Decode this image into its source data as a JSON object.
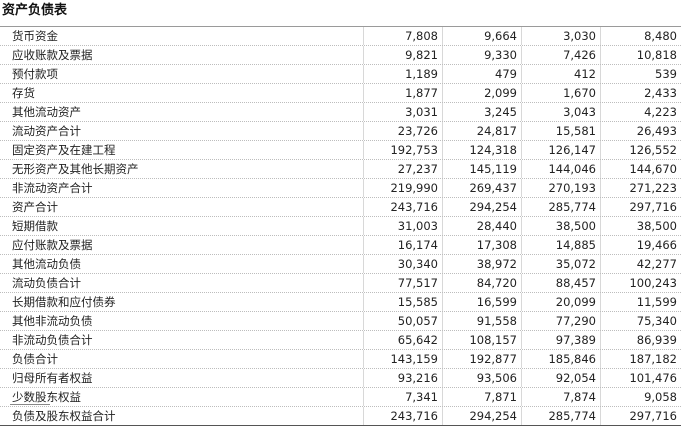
{
  "title": "资产负债表",
  "rows": [
    {
      "label": "货币资金",
      "values": [
        "7,808",
        "9,664",
        "3,030",
        "8,480"
      ]
    },
    {
      "label": "应收账款及票据",
      "values": [
        "9,821",
        "9,330",
        "7,426",
        "10,818"
      ]
    },
    {
      "label": "预付款项",
      "values": [
        "1,189",
        "479",
        "412",
        "539"
      ]
    },
    {
      "label": "存货",
      "values": [
        "1,877",
        "2,099",
        "1,670",
        "2,433"
      ]
    },
    {
      "label": "其他流动资产",
      "values": [
        "3,031",
        "3,245",
        "3,043",
        "4,223"
      ]
    },
    {
      "label": "流动资产合计",
      "values": [
        "23,726",
        "24,817",
        "15,581",
        "26,493"
      ]
    },
    {
      "label": "固定资产及在建工程",
      "values": [
        "192,753",
        "124,318",
        "126,147",
        "126,552"
      ]
    },
    {
      "label": "无形资产及其他长期资产",
      "values": [
        "27,237",
        "145,119",
        "144,046",
        "144,670"
      ]
    },
    {
      "label": "非流动资产合计",
      "values": [
        "219,990",
        "269,437",
        "270,193",
        "271,223"
      ]
    },
    {
      "label": "资产合计",
      "values": [
        "243,716",
        "294,254",
        "285,774",
        "297,716"
      ]
    },
    {
      "label": "短期借款",
      "values": [
        "31,003",
        "28,440",
        "38,500",
        "38,500"
      ]
    },
    {
      "label": "应付账款及票据",
      "values": [
        "16,174",
        "17,308",
        "14,885",
        "19,466"
      ]
    },
    {
      "label": "其他流动负债",
      "values": [
        "30,340",
        "38,972",
        "35,072",
        "42,277"
      ]
    },
    {
      "label": "流动负债合计",
      "values": [
        "77,517",
        "84,720",
        "88,457",
        "100,243"
      ]
    },
    {
      "label": "长期借款和应付债券",
      "values": [
        "15,585",
        "16,599",
        "20,099",
        "11,599"
      ]
    },
    {
      "label": "其他非流动负债",
      "values": [
        "50,057",
        "91,558",
        "77,290",
        "75,340"
      ]
    },
    {
      "label": "非流动负债合计",
      "values": [
        "65,642",
        "108,157",
        "97,389",
        "86,939"
      ]
    },
    {
      "label": "负债合计",
      "values": [
        "143,159",
        "192,877",
        "185,846",
        "187,182"
      ]
    },
    {
      "label": "归母所有者权益",
      "values": [
        "93,216",
        "93,506",
        "92,054",
        "101,476"
      ]
    },
    {
      "label": "少数股东权益",
      "values": [
        "7,341",
        "7,871",
        "7,874",
        "9,058"
      ]
    },
    {
      "label": "负债及股东权益合计",
      "values": [
        "243,716",
        "294,254",
        "285,774",
        "297,716"
      ]
    }
  ]
}
